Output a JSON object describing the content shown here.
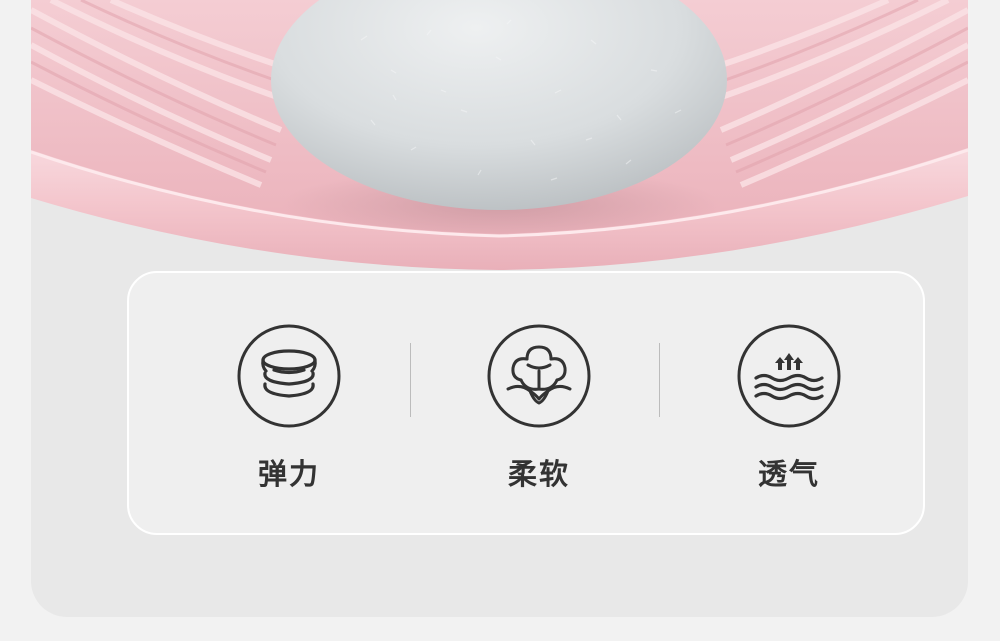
{
  "colors": {
    "page_background": "#f2f2f2",
    "panel_background": "#e8e8e8",
    "fabric_pink": "#f1c3ca",
    "ball_grey": "#d8dcdd",
    "icon_stroke": "#333333"
  },
  "features": [
    {
      "label": "弹力",
      "icon": "stacked-layers-icon"
    },
    {
      "label": "柔软",
      "icon": "cotton-icon"
    },
    {
      "label": "透气",
      "icon": "breathable-waves-icon"
    }
  ]
}
